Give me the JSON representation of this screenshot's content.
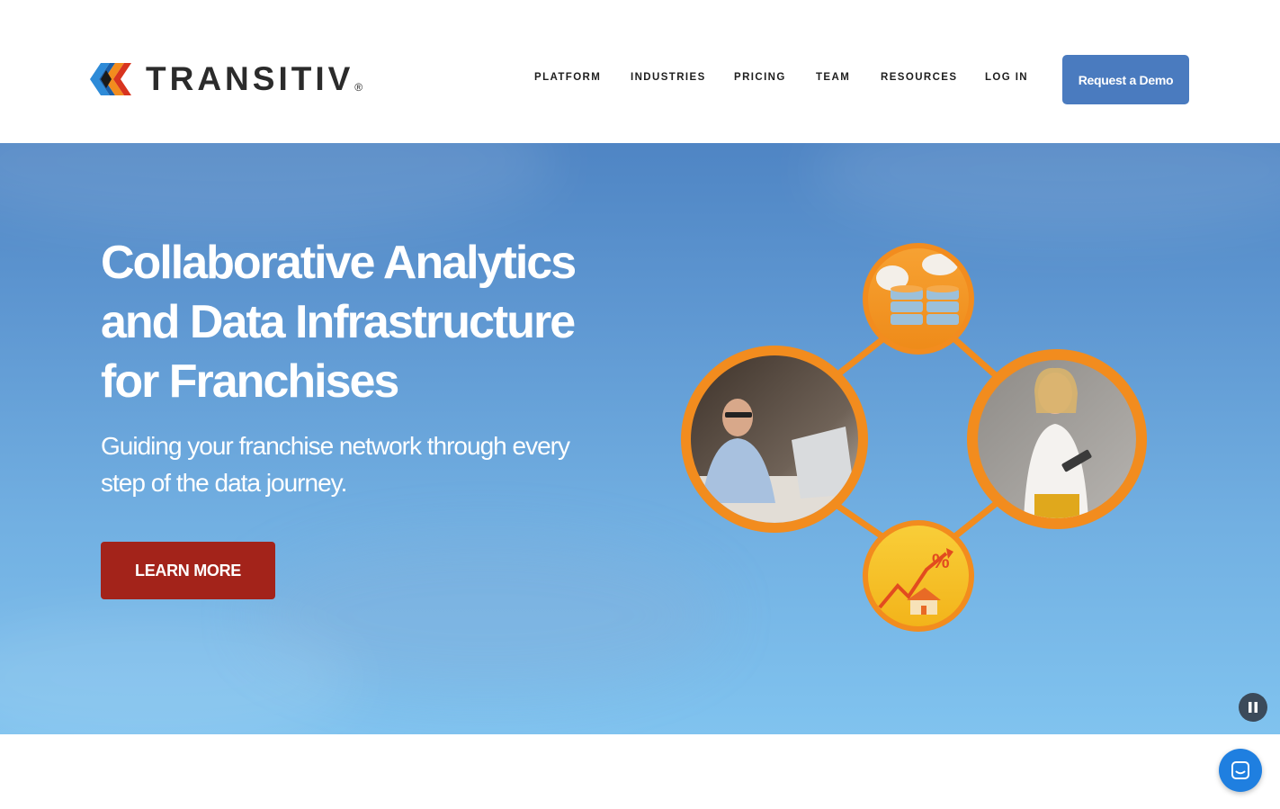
{
  "header": {
    "logo_text": "TRANSITIV",
    "logo_reg": "®",
    "nav": [
      {
        "label": "PLATFORM"
      },
      {
        "label": "INDUSTRIES"
      },
      {
        "label": "PRICING"
      },
      {
        "label": "TEAM"
      },
      {
        "label": "RESOURCES"
      },
      {
        "label": "LOG IN"
      }
    ],
    "cta_label": "Request a Demo"
  },
  "hero": {
    "title": "Collaborative Analytics and Data Infrastructure for Franchises",
    "subtitle": "Guiding your franchise network through every step of the data journey.",
    "cta_label": "LEARN MORE"
  },
  "colors": {
    "brand_blue": "#4a7bbf",
    "cta_red": "#a3231a",
    "ring_orange": "#f28c1e",
    "chat_blue": "#1f7fe0"
  },
  "icons": {
    "pause": "pause-icon",
    "chat": "chat-icon",
    "logo_mark": "transitiv-logo-mark"
  }
}
